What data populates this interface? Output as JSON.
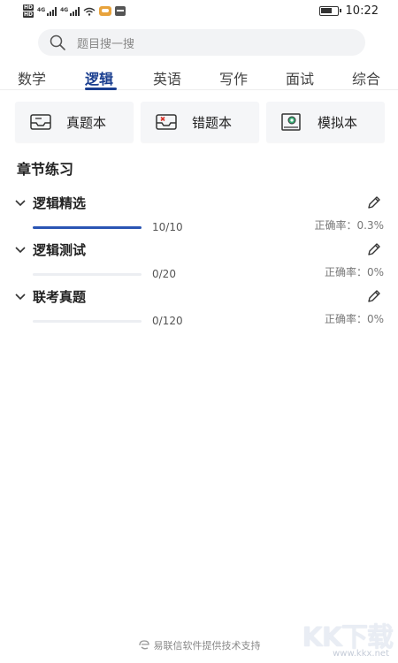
{
  "status_bar": {
    "hd1": "HD",
    "hd2": "HD",
    "signal1": "4G",
    "signal2": "4G",
    "time": "10:22"
  },
  "search": {
    "placeholder": "题目搜一搜"
  },
  "tabs": [
    {
      "label": "数学",
      "active": false
    },
    {
      "label": "逻辑",
      "active": true
    },
    {
      "label": "英语",
      "active": false
    },
    {
      "label": "写作",
      "active": false
    },
    {
      "label": "面试",
      "active": false
    },
    {
      "label": "综合",
      "active": false
    }
  ],
  "books": [
    {
      "label": "真题本",
      "icon": "inbox-icon"
    },
    {
      "label": "错题本",
      "icon": "wrong-inbox-icon"
    },
    {
      "label": "模拟本",
      "icon": "certificate-icon"
    }
  ],
  "section": {
    "title": "章节练习"
  },
  "chapters": [
    {
      "title": "逻辑精选",
      "count": "10/10",
      "accuracy": "正确率：0.3%",
      "progress": 1.0
    },
    {
      "title": "逻辑测试",
      "count": "0/20",
      "accuracy": "正确率：0%",
      "progress": 0.0
    },
    {
      "title": "联考真题",
      "count": "0/120",
      "accuracy": "正确率：0%",
      "progress": 0.0
    }
  ],
  "footer": {
    "text": "易联信软件提供技术支持"
  },
  "watermark": {
    "logo": "KK下载",
    "url": "www.kkx.net"
  },
  "colors": {
    "accent": "#1a3e8f",
    "progress": "#2a55b4",
    "book_bg": "#f5f6f8",
    "search_bg": "#f2f3f5"
  }
}
